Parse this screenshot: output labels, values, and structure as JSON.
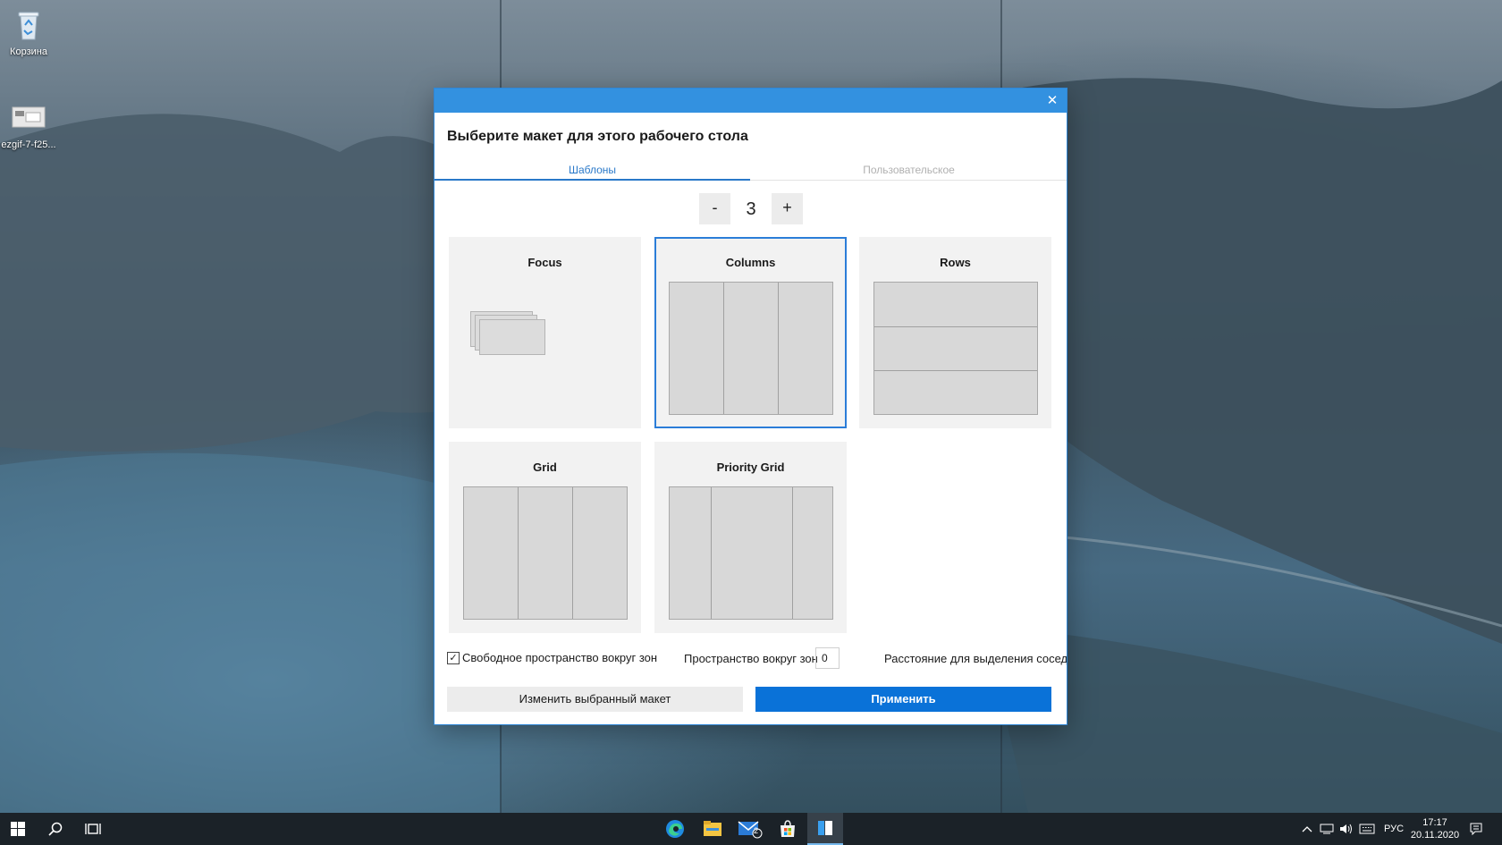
{
  "desktop": {
    "icons": [
      {
        "label": "Корзина",
        "icon": "recycle-bin-icon"
      },
      {
        "label": "ezgif-7-f25...",
        "icon": "image-file-icon"
      }
    ]
  },
  "dialog": {
    "close_symbol": "✕",
    "heading": "Выберите макет для этого рабочего стола",
    "tabs": [
      {
        "label": "Шаблоны",
        "active": true
      },
      {
        "label": "Пользовательское",
        "active": false
      }
    ],
    "zone_count": {
      "minus_label": "-",
      "value": "3",
      "plus_label": "+"
    },
    "layouts": [
      {
        "name": "Focus",
        "selected": false
      },
      {
        "name": "Columns",
        "selected": true
      },
      {
        "name": "Rows",
        "selected": false
      },
      {
        "name": "Grid",
        "selected": false
      },
      {
        "name": "Priority Grid",
        "selected": false
      }
    ],
    "options": {
      "free_space_checked": true,
      "check_mark": "✓",
      "free_space_label": "Свободное пространство вокруг зон",
      "space_around_label": "Пространство вокруг зон",
      "space_around_value": "0",
      "distance_label": "Расстояние для выделения соседних зон"
    },
    "edit_button": "Изменить выбранный макет",
    "apply_button": "Применить"
  },
  "taskbar": {
    "pinned": [
      "edge-icon",
      "file-explorer-icon",
      "mail-icon",
      "store-icon",
      "fancyzones-icon"
    ],
    "mail_badge": "2",
    "language": "РУС",
    "time": "17:17",
    "date": "20.11.2020"
  },
  "colors": {
    "accent": "#0a72d8",
    "titlebar": "#3391e0",
    "taskbar": "#1b2228"
  }
}
